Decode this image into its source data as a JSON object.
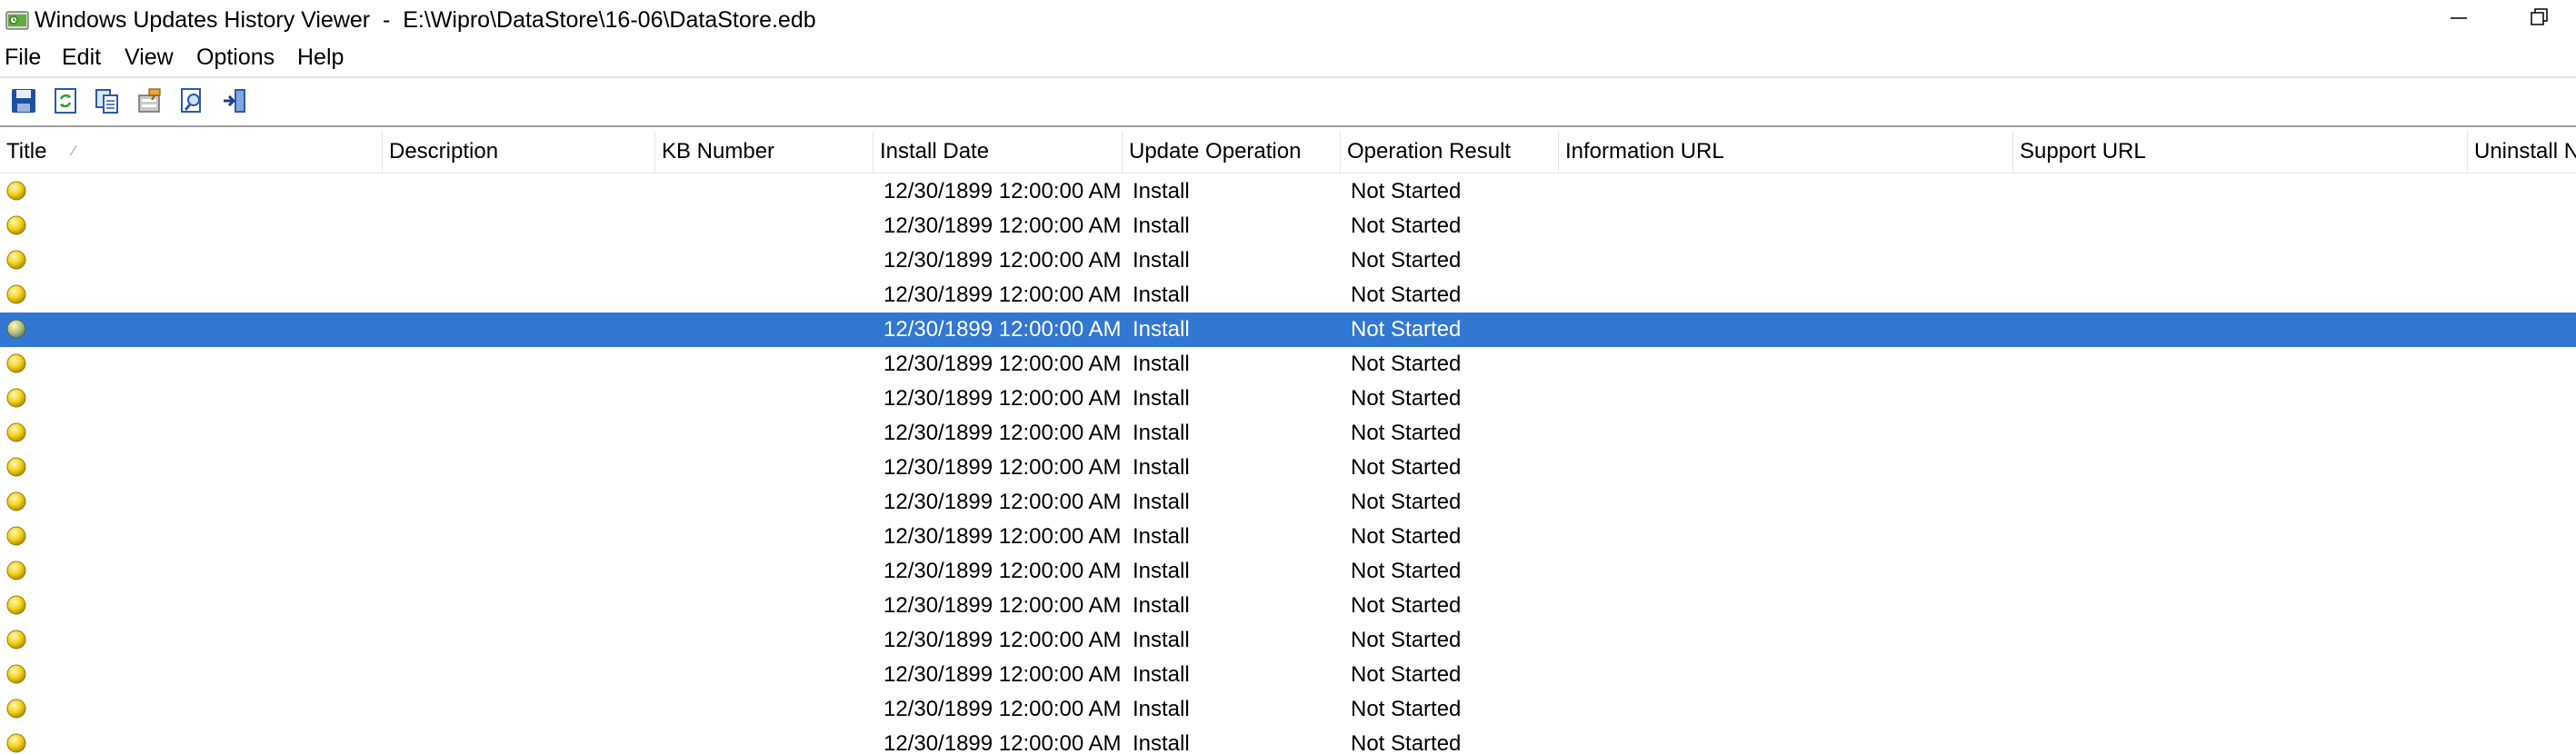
{
  "window": {
    "title": "Windows Updates History Viewer  -  E:\\Wipro\\DataStore\\16-06\\DataStore.edb"
  },
  "menu": [
    {
      "label": "File"
    },
    {
      "label": "Edit"
    },
    {
      "label": "View"
    },
    {
      "label": "Options"
    },
    {
      "label": "Help"
    }
  ],
  "toolbar": {
    "buttons": [
      {
        "icon": "save-icon"
      },
      {
        "icon": "refresh-icon"
      },
      {
        "icon": "copy-icon"
      },
      {
        "icon": "properties-icon"
      },
      {
        "icon": "find-icon"
      },
      {
        "icon": "exit-icon"
      }
    ]
  },
  "columns": [
    {
      "label": "Title"
    },
    {
      "label": "Description"
    },
    {
      "label": "KB Number"
    },
    {
      "label": "Install Date"
    },
    {
      "label": "Update Operation"
    },
    {
      "label": "Operation Result"
    },
    {
      "label": "Information URL"
    },
    {
      "label": "Support URL"
    },
    {
      "label": "Uninstall N"
    }
  ],
  "sort": {
    "column": "Title",
    "indicator": "⁄"
  },
  "rows": [
    {
      "title": "",
      "description": "",
      "kb": "",
      "install_date": "12/30/1899 12:00:00 AM",
      "operation": "Install",
      "result": "Not Started",
      "selected": false
    },
    {
      "title": "",
      "description": "",
      "kb": "",
      "install_date": "12/30/1899 12:00:00 AM",
      "operation": "Install",
      "result": "Not Started",
      "selected": false
    },
    {
      "title": "",
      "description": "",
      "kb": "",
      "install_date": "12/30/1899 12:00:00 AM",
      "operation": "Install",
      "result": "Not Started",
      "selected": false
    },
    {
      "title": "",
      "description": "",
      "kb": "",
      "install_date": "12/30/1899 12:00:00 AM",
      "operation": "Install",
      "result": "Not Started",
      "selected": false
    },
    {
      "title": "",
      "description": "",
      "kb": "",
      "install_date": "12/30/1899 12:00:00 AM",
      "operation": "Install",
      "result": "Not Started",
      "selected": true
    },
    {
      "title": "",
      "description": "",
      "kb": "",
      "install_date": "12/30/1899 12:00:00 AM",
      "operation": "Install",
      "result": "Not Started",
      "selected": false
    },
    {
      "title": "",
      "description": "",
      "kb": "",
      "install_date": "12/30/1899 12:00:00 AM",
      "operation": "Install",
      "result": "Not Started",
      "selected": false
    },
    {
      "title": "",
      "description": "",
      "kb": "",
      "install_date": "12/30/1899 12:00:00 AM",
      "operation": "Install",
      "result": "Not Started",
      "selected": false
    },
    {
      "title": "",
      "description": "",
      "kb": "",
      "install_date": "12/30/1899 12:00:00 AM",
      "operation": "Install",
      "result": "Not Started",
      "selected": false
    },
    {
      "title": "",
      "description": "",
      "kb": "",
      "install_date": "12/30/1899 12:00:00 AM",
      "operation": "Install",
      "result": "Not Started",
      "selected": false
    },
    {
      "title": "",
      "description": "",
      "kb": "",
      "install_date": "12/30/1899 12:00:00 AM",
      "operation": "Install",
      "result": "Not Started",
      "selected": false
    },
    {
      "title": "",
      "description": "",
      "kb": "",
      "install_date": "12/30/1899 12:00:00 AM",
      "operation": "Install",
      "result": "Not Started",
      "selected": false
    },
    {
      "title": "",
      "description": "",
      "kb": "",
      "install_date": "12/30/1899 12:00:00 AM",
      "operation": "Install",
      "result": "Not Started",
      "selected": false
    },
    {
      "title": "",
      "description": "",
      "kb": "",
      "install_date": "12/30/1899 12:00:00 AM",
      "operation": "Install",
      "result": "Not Started",
      "selected": false
    },
    {
      "title": "",
      "description": "",
      "kb": "",
      "install_date": "12/30/1899 12:00:00 AM",
      "operation": "Install",
      "result": "Not Started",
      "selected": false
    },
    {
      "title": "",
      "description": "",
      "kb": "",
      "install_date": "12/30/1899 12:00:00 AM",
      "operation": "Install",
      "result": "Not Started",
      "selected": false
    },
    {
      "title": "",
      "description": "",
      "kb": "",
      "install_date": "12/30/1899 12:00:00 AM",
      "operation": "Install",
      "result": "Not Started",
      "selected": false
    }
  ],
  "colors": {
    "selection": "#3277d2",
    "status_bulb": "#f2d31c",
    "header_separator": "#e5e5e5"
  }
}
